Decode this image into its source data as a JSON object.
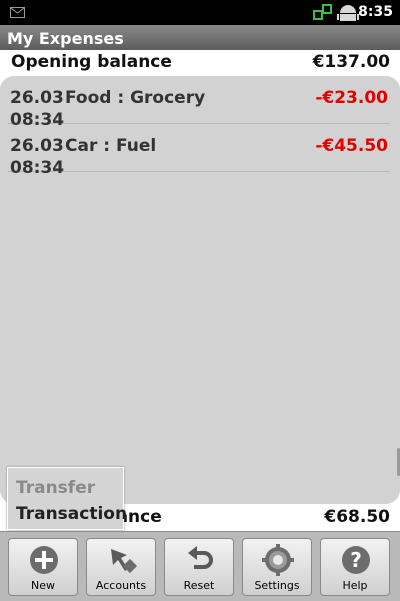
{
  "status": {
    "time": "8:35"
  },
  "app": {
    "title": "My Expenses"
  },
  "opening": {
    "label": "Opening balance",
    "amount": "€137.00"
  },
  "transactions": [
    {
      "date": "26.03",
      "time": "08:34",
      "category": "Food : Grocery",
      "amount": "-€23.00"
    },
    {
      "date": "26.03",
      "time": "08:34",
      "category": "Car : Fuel",
      "amount": "-€45.50"
    }
  ],
  "closing": {
    "label": "Closing balance",
    "amount": "€68.50"
  },
  "popup": {
    "items": [
      "Transfer",
      "Transaction"
    ]
  },
  "toolbar": {
    "buttons": [
      {
        "label": "New",
        "icon": "plus-icon"
      },
      {
        "label": "Accounts",
        "icon": "accounts-icon"
      },
      {
        "label": "Reset",
        "icon": "reset-icon"
      },
      {
        "label": "Settings",
        "icon": "settings-gear-icon"
      },
      {
        "label": "Help",
        "icon": "help-icon"
      }
    ]
  },
  "colors": {
    "negative": "#e00000",
    "panel": "#d2d2d2",
    "title_bar": "#6e6e6e"
  }
}
